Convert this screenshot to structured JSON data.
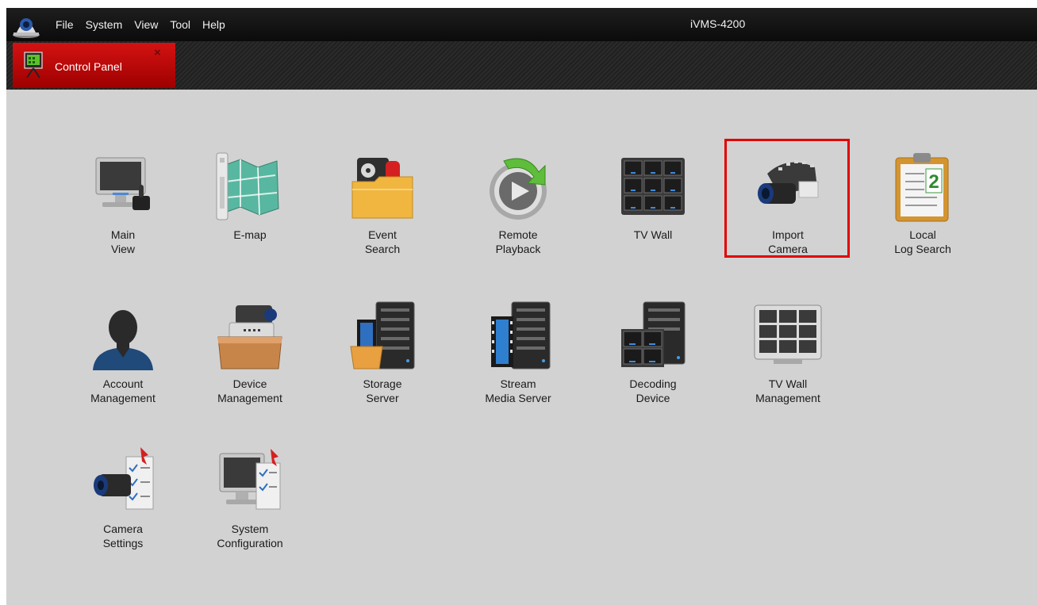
{
  "app": {
    "title": "iVMS-4200"
  },
  "menu": [
    "File",
    "System",
    "View",
    "Tool",
    "Help"
  ],
  "tab": {
    "label": "Control Panel",
    "close": "×"
  },
  "colors": {
    "accent": "#d40e0e",
    "highlight": "#e10000",
    "background": "#d2d2d2"
  },
  "items": [
    {
      "name": "main-view",
      "icon": "monitor-joystick-icon",
      "lines": [
        "Main",
        "View"
      ]
    },
    {
      "name": "e-map",
      "icon": "map-icon",
      "lines": [
        "E-map",
        ""
      ]
    },
    {
      "name": "event-search",
      "icon": "folder-event-icon",
      "lines": [
        "Event",
        "Search"
      ]
    },
    {
      "name": "remote-playback",
      "icon": "playback-icon",
      "lines": [
        "Remote",
        "Playback"
      ]
    },
    {
      "name": "tv-wall",
      "icon": "tv-wall-icon",
      "lines": [
        "TV Wall",
        ""
      ]
    },
    {
      "name": "import-camera",
      "icon": "camera-film-icon",
      "lines": [
        "Import",
        "Camera"
      ]
    },
    {
      "name": "local-log-search",
      "icon": "clipboard-log-icon",
      "lines": [
        "Local",
        "Log Search"
      ]
    },
    {
      "name": "account-management",
      "icon": "user-silhouette-icon",
      "lines": [
        "Account",
        "Management"
      ]
    },
    {
      "name": "device-management",
      "icon": "device-box-icon",
      "lines": [
        "Device",
        "Management"
      ]
    },
    {
      "name": "storage-server",
      "icon": "storage-server-icon",
      "lines": [
        "Storage",
        "Server"
      ]
    },
    {
      "name": "stream-media-server",
      "icon": "stream-server-icon",
      "lines": [
        "Stream",
        "Media Server"
      ]
    },
    {
      "name": "decoding-device",
      "icon": "decoding-device-icon",
      "lines": [
        "Decoding",
        "Device"
      ]
    },
    {
      "name": "tv-wall-management",
      "icon": "tv-wall-grid-icon",
      "lines": [
        "TV Wall",
        "Management"
      ]
    },
    {
      "name": "camera-settings",
      "icon": "camera-settings-icon",
      "lines": [
        "Camera",
        "Settings"
      ]
    },
    {
      "name": "system-configuration",
      "icon": "system-config-icon",
      "lines": [
        "System",
        "Configuration"
      ]
    }
  ]
}
